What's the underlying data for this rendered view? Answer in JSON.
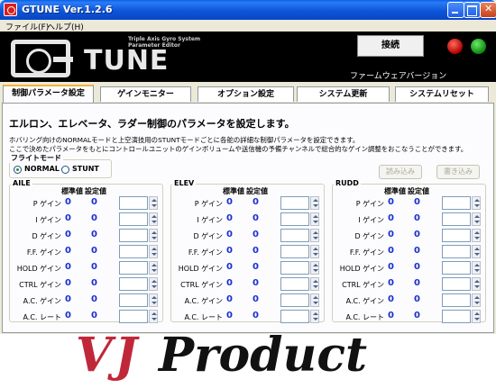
{
  "window": {
    "title": "GTUNE Ver.1.2.6"
  },
  "menu": [
    {
      "label": "ファイル(F)"
    },
    {
      "label": "ヘルプ(H)"
    }
  ],
  "header": {
    "logo_letter": "G",
    "logo_text": "TUNE",
    "logo_sub1": "Triple Axis Gyro System",
    "logo_sub2": "Parameter Editor",
    "connect_label": "接続",
    "firmware_label": "ファームウェアバージョン",
    "status_colors": {
      "red": "#cc1010",
      "green": "#18a018"
    }
  },
  "tabs": [
    {
      "label": "制御パラメータ設定",
      "active": true
    },
    {
      "label": "ゲインモニター"
    },
    {
      "label": "オプション設定"
    },
    {
      "label": "システム更新"
    },
    {
      "label": "システムリセット"
    }
  ],
  "panel": {
    "heading": "エルロン、エレベータ、ラダー制御のパラメータを設定します。",
    "desc1": "ホバリング向けのNORMALモードと上空演技用のSTUNTモードごとに各舵の詳細な制御パラメータを設定できます。",
    "desc2": "ここで決めたパラメータをもとにコントロールユニットのゲインボリュームや送信機の予備チャンネルで総合的なゲイン調整をおこなうことができます。",
    "flight_mode": {
      "legend": "フライトモード",
      "options": [
        "NORMAL",
        "STUNT"
      ],
      "selected": "NORMAL"
    },
    "read_label": "読み込み",
    "write_label": "書き込み",
    "col_std": "標準値",
    "col_set": "設定値",
    "axes": [
      {
        "title": "AILE"
      },
      {
        "title": "ELEV"
      },
      {
        "title": "RUDD"
      }
    ],
    "rows": [
      {
        "label": "P ゲイン",
        "std": "0",
        "set": "0"
      },
      {
        "label": "I ゲイン",
        "std": "0",
        "set": "0"
      },
      {
        "label": "D ゲイン",
        "std": "0",
        "set": "0"
      },
      {
        "label": "F.F. ゲイン",
        "std": "0",
        "set": "0"
      },
      {
        "label": "HOLD ゲイン",
        "std": "0",
        "set": "0"
      },
      {
        "label": "CTRL ゲイン",
        "std": "0",
        "set": "0"
      },
      {
        "label": "A.C. ゲイン",
        "std": "0",
        "set": "0"
      },
      {
        "label": "A.C. レート",
        "std": "0",
        "set": "0"
      }
    ]
  },
  "footer": {
    "brand1": "VJ",
    "brand2": "Product",
    "brand_color": "#c0283a"
  }
}
